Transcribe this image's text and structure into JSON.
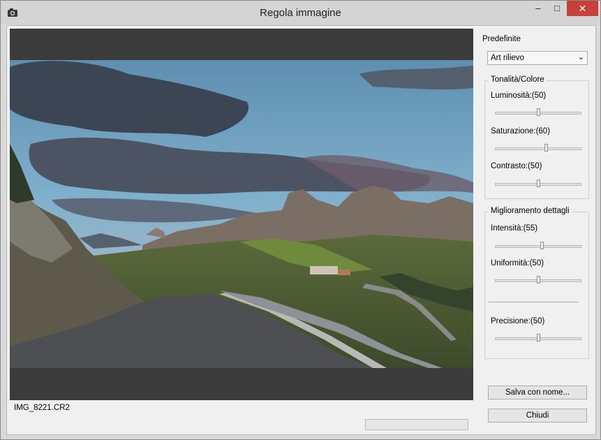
{
  "window": {
    "title": "Regola immagine",
    "controls": {
      "minimize": "–",
      "maximize": "□",
      "close": "✕"
    },
    "icon": "camera-icon"
  },
  "preview": {
    "filename": "IMG_8221.CR2",
    "progress": 0
  },
  "sidebar": {
    "presets_label": "Predefinite",
    "preset_value": "Art rilievo",
    "tone_group": {
      "title": "Tonalità/Colore",
      "sliders": [
        {
          "label": "Luminosità:(50)",
          "value": 50
        },
        {
          "label": "Saturazione:(60)",
          "value": 60
        },
        {
          "label": "Contrasto:(50)",
          "value": 50
        }
      ]
    },
    "detail_group": {
      "title": "Miglioramento dettagli",
      "sliders": [
        {
          "label": "Intensità:(55)",
          "value": 55
        },
        {
          "label": "Uniformità:(50)",
          "value": 50
        },
        {
          "label": "Precisione:(50)",
          "value": 50
        }
      ]
    },
    "save_label": "Salva con nome...",
    "close_label": "Chiudi"
  }
}
